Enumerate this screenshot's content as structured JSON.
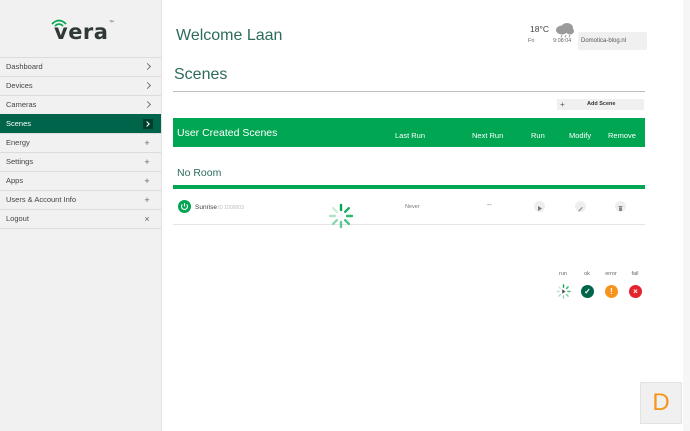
{
  "logo": {
    "text": "vera",
    "trademark": "™"
  },
  "nav": [
    {
      "label": "Dashboard",
      "indicator": "chevron"
    },
    {
      "label": "Devices",
      "indicator": "chevron"
    },
    {
      "label": "Cameras",
      "indicator": "chevron"
    },
    {
      "label": "Scenes",
      "indicator": "chevron",
      "active": true
    },
    {
      "label": "Energy",
      "indicator": "+"
    },
    {
      "label": "Settings",
      "indicator": "+"
    },
    {
      "label": "Apps",
      "indicator": "+"
    },
    {
      "label": "Users & Account Info",
      "indicator": "+"
    },
    {
      "label": "Logout",
      "indicator": "×"
    }
  ],
  "header": {
    "welcome": "Welcome Laan",
    "weather": {
      "temp": "18°C",
      "day": "Fri",
      "time": "9:08:04",
      "icon": "cloud-rain-icon"
    },
    "account": "Domotica-blog.nl"
  },
  "page": {
    "title": "Scenes",
    "add_scene": "Add Scene",
    "add_plus": "+"
  },
  "table": {
    "title": "User Created Scenes",
    "columns": [
      "Last Run",
      "Next Run",
      "Run",
      "Modify",
      "Remove"
    ]
  },
  "room": {
    "name": "No Room"
  },
  "scene": {
    "name": "Sunrise",
    "sub": "ID 1000003",
    "last_run": "Never",
    "next_run": "--"
  },
  "legend": [
    {
      "label": "run",
      "color": "#ffffff",
      "glyph": "▶"
    },
    {
      "label": "ok",
      "color": "#00644a",
      "glyph": "✓"
    },
    {
      "label": "error",
      "color": "#f7941d",
      "glyph": "!"
    },
    {
      "label": "fail",
      "color": "#e4232b",
      "glyph": "×"
    }
  ],
  "badge": {
    "letter": "D"
  },
  "colors": {
    "brand": "#00a651",
    "dark": "#00644a",
    "accent": "#f7941d"
  }
}
